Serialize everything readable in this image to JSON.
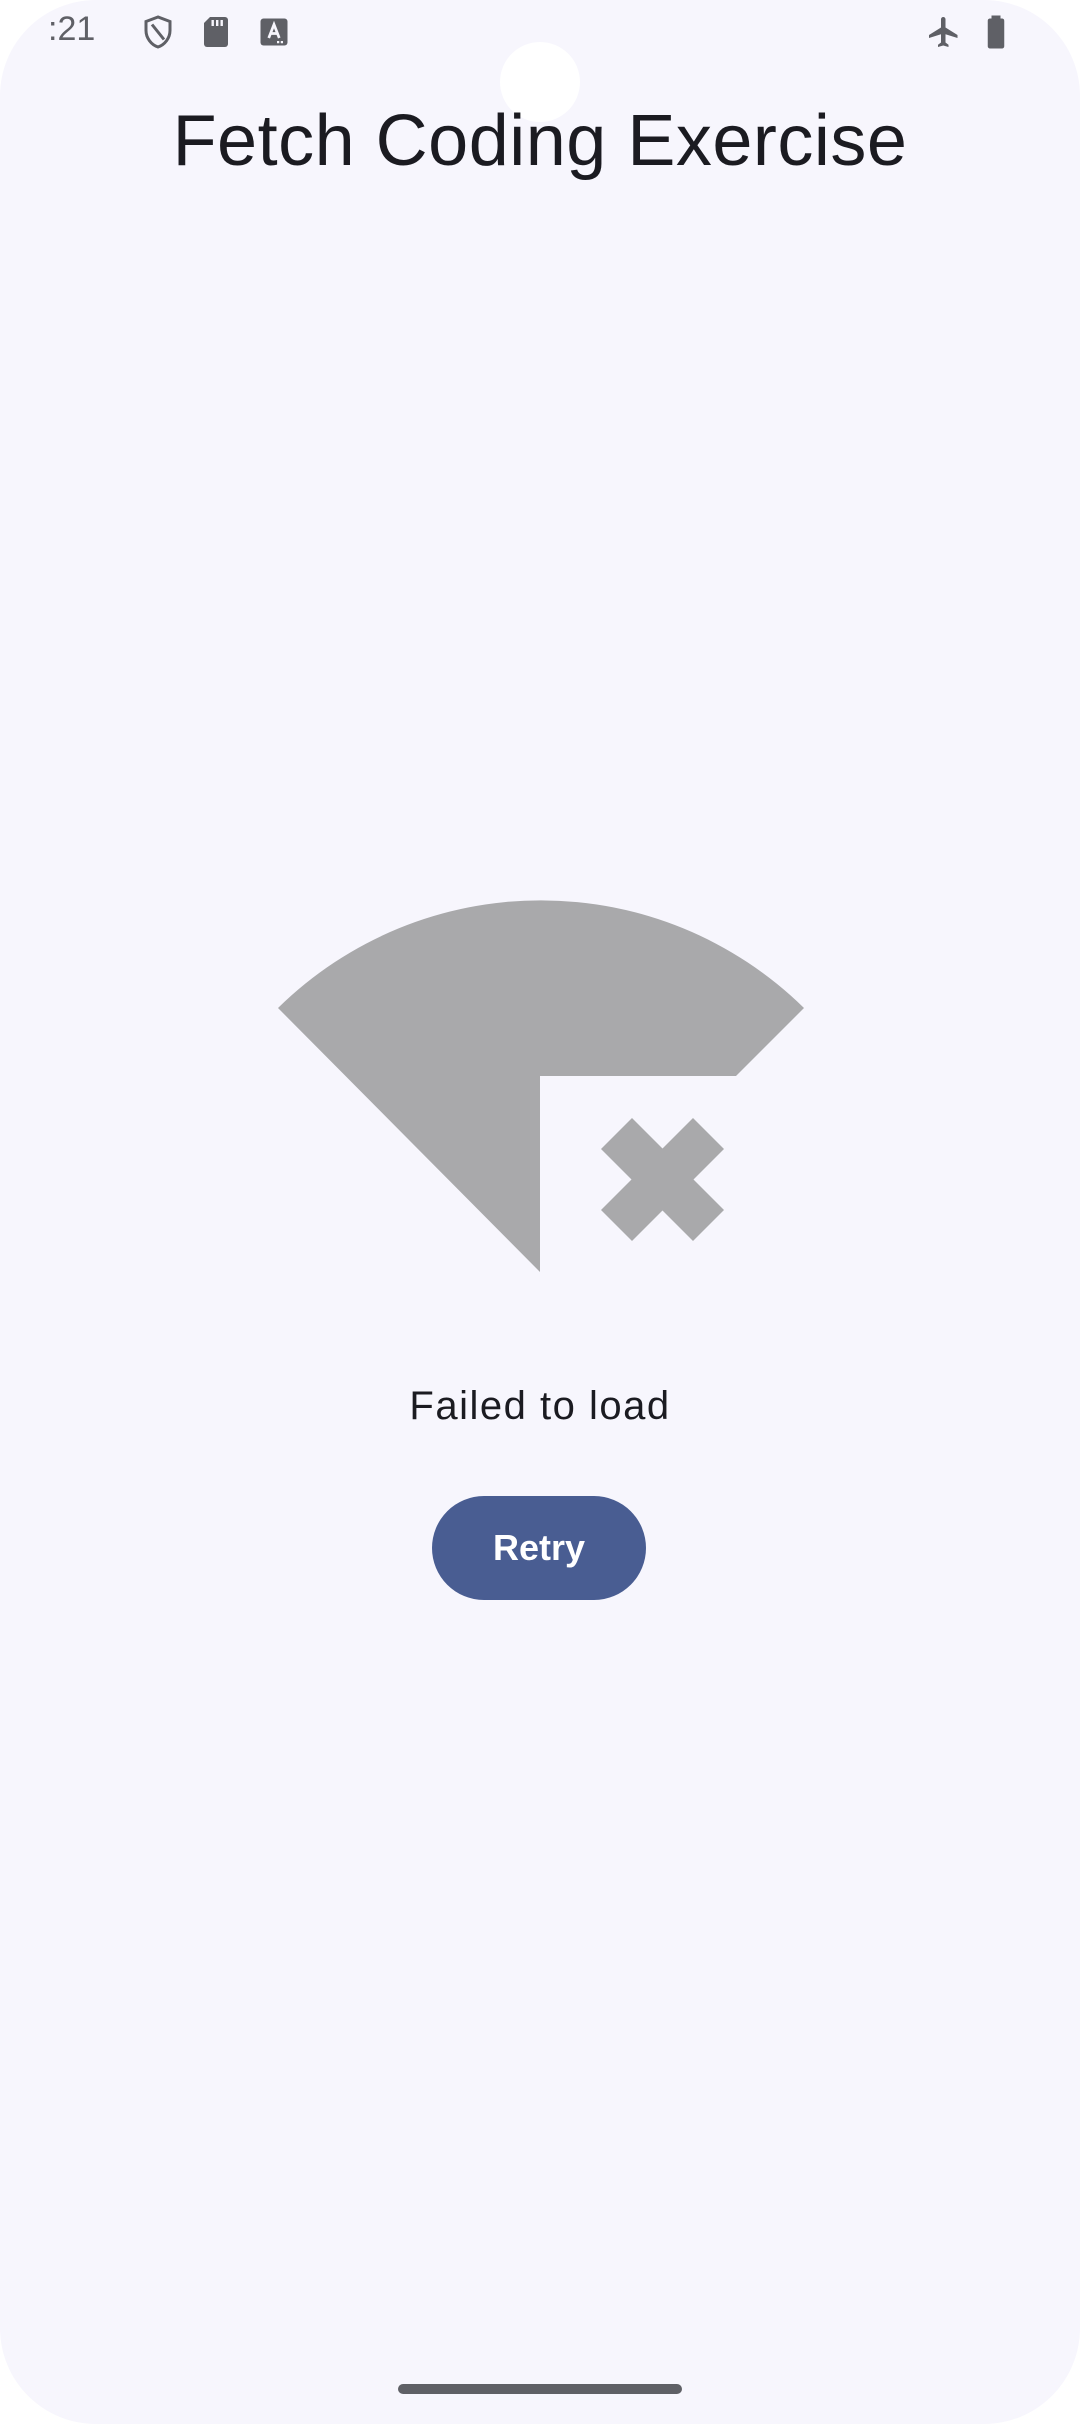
{
  "status_bar": {
    "time": ":21",
    "icons": [
      "shield-icon",
      "sd-card-icon",
      "font-a-icon",
      "airplane-mode-icon",
      "battery-icon"
    ]
  },
  "app": {
    "title": "Fetch Coding Exercise"
  },
  "error_state": {
    "illustration": "wifi-off-icon",
    "message": "Failed to load",
    "retry_label": "Retry"
  },
  "colors": {
    "background": "#f7f6fd",
    "primary": "#495d92",
    "illustration_gray": "#a9a9ab",
    "text": "#1b1b21",
    "status_icon": "#5f6066"
  }
}
